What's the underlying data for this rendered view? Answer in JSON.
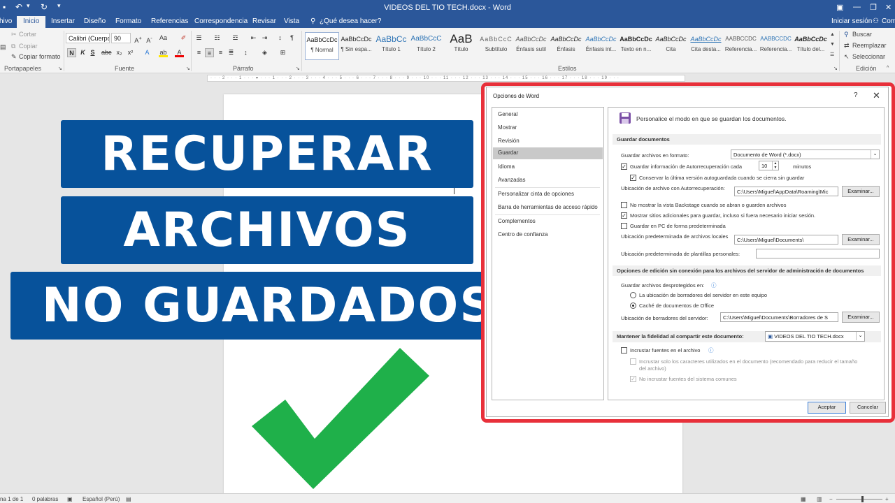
{
  "window": {
    "title": "VIDEOS DEL TIO TECH.docx - Word",
    "controls": {
      "minimize": "—",
      "restore": "❐",
      "close": "✕"
    },
    "quick_access": {
      "save_icon": "save-icon",
      "undo_icon": "undo-icon",
      "redo_icon": "redo-icon"
    },
    "sign_in": "Iniciar sesión",
    "share": "Com"
  },
  "tabs": [
    "hivo",
    "Inicio",
    "Insertar",
    "Diseño",
    "Formato",
    "Referencias",
    "Correspondencia",
    "Revisar",
    "Vista"
  ],
  "tell_me": "¿Qué desea hacer?",
  "ribbon": {
    "clipboard": {
      "cut": "Cortar",
      "copy": "Copiar",
      "format_painter": "Copiar formato",
      "group": "Portapapeles"
    },
    "font": {
      "name": "Calibri (Cuerpo)",
      "size": "90",
      "group": "Fuente",
      "buttons": [
        "N",
        "K",
        "S"
      ]
    },
    "paragraph": {
      "group": "Párrafo"
    },
    "styles": {
      "group": "Estilos",
      "items": [
        {
          "preview": "AaBbCcDc",
          "name": "¶ Normal"
        },
        {
          "preview": "AaBbCcDc",
          "name": "¶ Sin espa..."
        },
        {
          "preview": "AaBbCc",
          "name": "Título 1"
        },
        {
          "preview": "AaBbCcC",
          "name": "Título 2"
        },
        {
          "preview": "AaB",
          "name": "Título"
        },
        {
          "preview": "AaBbCcC",
          "name": "Subtítulo"
        },
        {
          "preview": "AaBbCcDc",
          "name": "Énfasis sutil"
        },
        {
          "preview": "AaBbCcDc",
          "name": "Énfasis"
        },
        {
          "preview": "AaBbCcDc",
          "name": "Énfasis int..."
        },
        {
          "preview": "AaBbCcDc",
          "name": "Texto en n..."
        },
        {
          "preview": "AaBbCcDc",
          "name": "Cita"
        },
        {
          "preview": "AaBbCcDc",
          "name": "Cita desta..."
        },
        {
          "preview": "AABBCCDC",
          "name": "Referencia..."
        },
        {
          "preview": "AABBCCDC",
          "name": "Referencia..."
        },
        {
          "preview": "AaBbCcDc",
          "name": "Título del..."
        }
      ]
    },
    "editing": {
      "find": "Buscar",
      "replace": "Reemplazar",
      "select": "Seleccionar",
      "group": "Edición"
    }
  },
  "overlay": {
    "line1": "RECUPERAR",
    "line2": "ARCHIVOS",
    "line3": "NO GUARDADOS"
  },
  "status": {
    "page": "na 1 de 1",
    "words": "0 palabras",
    "language": "Español (Perú)"
  },
  "dialog": {
    "title": "Opciones de Word",
    "help": "?",
    "close": "✕",
    "nav": [
      "General",
      "Mostrar",
      "Revisión",
      "Guardar",
      "Idioma",
      "Avanzadas",
      "Personalizar cinta de opciones",
      "Barra de herramientas de acceso rápido",
      "Complementos",
      "Centro de confianza"
    ],
    "header": "Personalice el modo en que se guardan los documentos.",
    "save_section": "Guardar documentos",
    "format_label": "Guardar archivos en formato:",
    "format_value": "Documento de Word (*.docx)",
    "autorecover_label": "Guardar información de Autorrecuperación cada",
    "autorecover_minutes": "10",
    "minutes_label": "minutos",
    "keep_last_label": "Conservar la última versión autoguardada cuando se cierra sin guardar",
    "autorecover_location_label": "Ubicación de archivo con Autorrecuperación:",
    "autorecover_location_value": "C:\\Users\\Miguel\\AppData\\Roaming\\Mic",
    "browse": "Examinar...",
    "no_backstage_label": "No mostrar la vista Backstage cuando se abran o guarden archivos",
    "show_places_label": "Mostrar sitios adicionales para guardar, incluso si fuera necesario iniciar sesión.",
    "save_to_pc_label": "Guardar en PC de forma predeterminada",
    "default_location_label": "Ubicación predeterminada de archivos locales",
    "default_location_value": "C:\\Users\\Miguel\\Documents\\",
    "templates_location_label": "Ubicación predeterminada de plantillas personales:",
    "templates_location_value": "",
    "offline_section": "Opciones de edición sin conexión para los archivos del servidor de administración de documentos",
    "checked_out_label": "Guardar archivos desprotegidos en:",
    "radio_server": "La ubicación de borradores del servidor en este equipo",
    "radio_cache": "Caché de documentos de Office",
    "drafts_location_label": "Ubicación de borradores del servidor:",
    "drafts_location_value": "C:\\Users\\Miguel\\Documents\\Borradores de S",
    "fidelity_label": "Mantener la fidelidad al compartir este documento:",
    "fidelity_doc": "VIDEOS DEL TIO TECH.docx",
    "embed_fonts_label": "Incrustar fuentes en el archivo",
    "embed_used_only_label1": "Incrustar solo los caracteres utilizados en el documento (recomendado para reducir el tamaño",
    "embed_used_only_label2": "del archivo)",
    "no_system_fonts_label": "No incrustar fuentes del sistema comunes",
    "ok": "Aceptar",
    "cancel": "Cancelar"
  },
  "colors": {
    "brand": "#2b579a",
    "overlay_box": "#07529b",
    "highlight": "#e8303a",
    "check": "#1fb04a"
  }
}
